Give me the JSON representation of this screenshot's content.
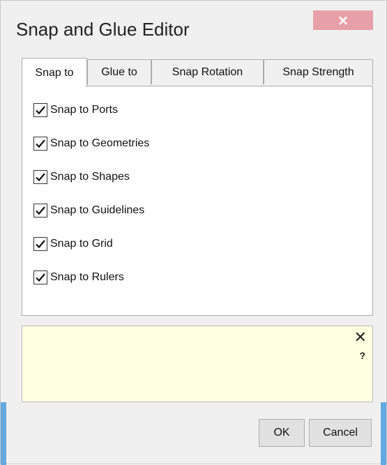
{
  "window": {
    "title": "Snap and Glue Editor",
    "close_label": "×"
  },
  "tabs": [
    {
      "label": "Snap to",
      "active": true
    },
    {
      "label": "Glue to",
      "active": false
    },
    {
      "label": "Snap Rotation",
      "active": false
    },
    {
      "label": "Snap Strength",
      "active": false
    }
  ],
  "snap_to": {
    "options": [
      {
        "label": "Snap to Ports",
        "checked": true
      },
      {
        "label": "Snap to Geometries",
        "checked": true
      },
      {
        "label": "Snap to Shapes",
        "checked": true
      },
      {
        "label": "Snap to Guidelines",
        "checked": true
      },
      {
        "label": "Snap to Grid",
        "checked": true
      },
      {
        "label": "Snap to Rulers",
        "checked": true
      }
    ]
  },
  "help": {
    "close_label": "✕",
    "question_label": "?"
  },
  "buttons": {
    "ok_label": "OK",
    "cancel_label": "Cancel"
  },
  "colors": {
    "close_button": "#e8a0a8",
    "help_background": "#ffffe1",
    "accent_blue": "#63a9e0"
  }
}
